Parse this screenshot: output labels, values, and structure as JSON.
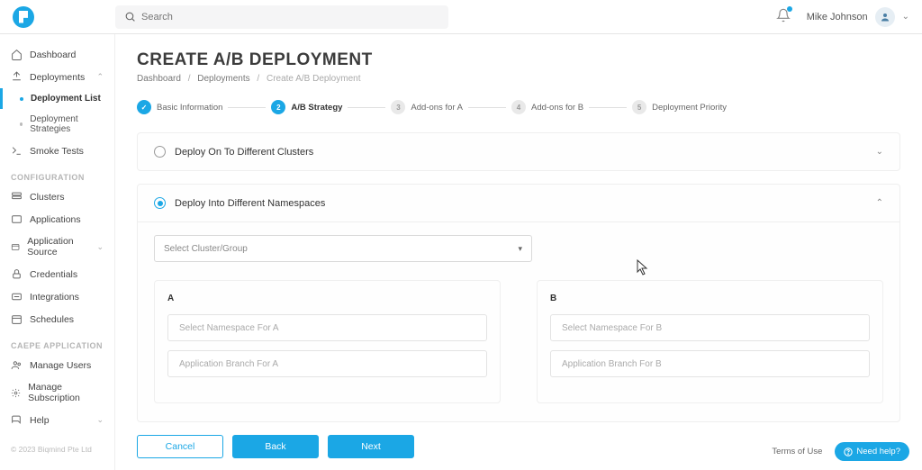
{
  "header": {
    "search_placeholder": "Search",
    "user_name": "Mike Johnson"
  },
  "sidebar": {
    "primary": [
      {
        "icon": "home-icon",
        "label": "Dashboard"
      },
      {
        "icon": "deploy-icon",
        "label": "Deployments",
        "expandable": true,
        "expanded": true
      },
      {
        "sub": true,
        "active": true,
        "label": "Deployment List"
      },
      {
        "sub": true,
        "label": "Deployment Strategies"
      },
      {
        "icon": "terminal-icon",
        "label": "Smoke Tests"
      }
    ],
    "config_label": "CONFIGURATION",
    "config": [
      {
        "icon": "stack-icon",
        "label": "Clusters"
      },
      {
        "icon": "app-icon",
        "label": "Applications"
      },
      {
        "icon": "source-icon",
        "label": "Application Source",
        "expandable": true
      },
      {
        "icon": "lock-icon",
        "label": "Credentials"
      },
      {
        "icon": "int-icon",
        "label": "Integrations"
      },
      {
        "icon": "cal-icon",
        "label": "Schedules"
      }
    ],
    "caepe_label": "CAEPE APPLICATION",
    "caepe": [
      {
        "icon": "users-icon",
        "label": "Manage Users"
      },
      {
        "icon": "gear-icon",
        "label": "Manage Subscription"
      },
      {
        "icon": "help-icon",
        "label": "Help",
        "expandable": true
      }
    ],
    "copyright": "© 2023 Biqmind Pte Ltd"
  },
  "page": {
    "title": "CREATE A/B DEPLOYMENT",
    "breadcrumb": [
      "Dashboard",
      "Deployments",
      "Create A/B Deployment"
    ]
  },
  "stepper": [
    {
      "num": "✓",
      "label": "Basic Information",
      "state": "done"
    },
    {
      "num": "2",
      "label": "A/B Strategy",
      "state": "active"
    },
    {
      "num": "3",
      "label": "Add-ons for A",
      "state": "pending"
    },
    {
      "num": "4",
      "label": "Add-ons for B",
      "state": "pending"
    },
    {
      "num": "5",
      "label": "Deployment Priority",
      "state": "pending"
    }
  ],
  "options": {
    "clusters_label": "Deploy On To Different Clusters",
    "namespaces_label": "Deploy Into Different Namespaces",
    "select_cluster_placeholder": "Select Cluster/Group",
    "col_a_label": "A",
    "col_b_label": "B",
    "ns_a_placeholder": "Select Namespace For A",
    "br_a_placeholder": "Application Branch For A",
    "ns_b_placeholder": "Select Namespace For B",
    "br_b_placeholder": "Application Branch For B"
  },
  "buttons": {
    "cancel": "Cancel",
    "back": "Back",
    "next": "Next"
  },
  "footer": {
    "tos": "Terms of Use",
    "help": "Need help?"
  }
}
